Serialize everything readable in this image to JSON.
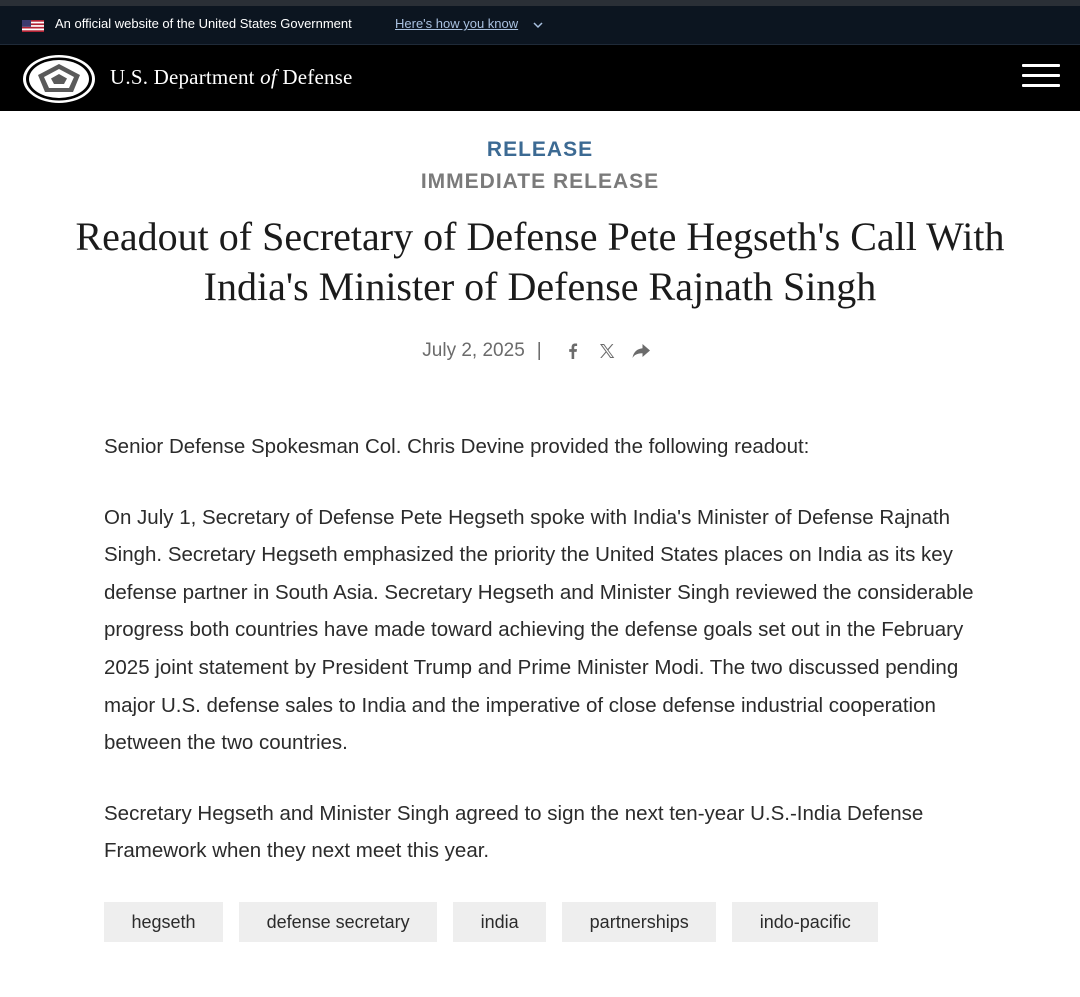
{
  "gov_banner": {
    "official_text": "An official website of the United States Government",
    "how_link": "Here's how you know"
  },
  "header": {
    "site_name_prefix": "U.S. Department ",
    "site_name_of": "of",
    "site_name_suffix": " Defense",
    "menu_icon": "hamburger-menu-icon"
  },
  "article": {
    "kicker": "RELEASE",
    "subkicker": "IMMEDIATE RELEASE",
    "title": "Readout of Secretary of Defense Pete Hegseth's Call With India's Minister of Defense Rajnath Singh",
    "date": "July 2, 2025",
    "separator": "|",
    "share_icons": [
      "facebook-icon",
      "x-icon",
      "share-icon"
    ],
    "paragraphs": [
      "Senior Defense Spokesman Col. Chris Devine provided the following readout:",
      "On July 1, Secretary of Defense Pete Hegseth spoke with India's Minister of Defense Rajnath Singh. Secretary Hegseth emphasized the priority the United States places on India as its key defense partner in South Asia. Secretary Hegseth and Minister Singh reviewed the considerable progress both countries have made toward achieving the defense goals set out in the February 2025 joint statement by President Trump and Prime Minister Modi. The two discussed pending major U.S. defense sales to India and the imperative of close defense industrial cooperation between the two countries.",
      "Secretary Hegseth and Minister Singh agreed to sign the next ten-year U.S.-India Defense Framework when they next meet this year."
    ],
    "tags": [
      "hegseth",
      "defense secretary",
      "india",
      "partnerships",
      "indo-pacific"
    ]
  },
  "colors": {
    "banner_bg": "#0c1520",
    "header_bg": "#000000",
    "kicker": "#3c6a93",
    "subkicker": "#7a7a7a",
    "tag_bg": "#eeeeee"
  }
}
